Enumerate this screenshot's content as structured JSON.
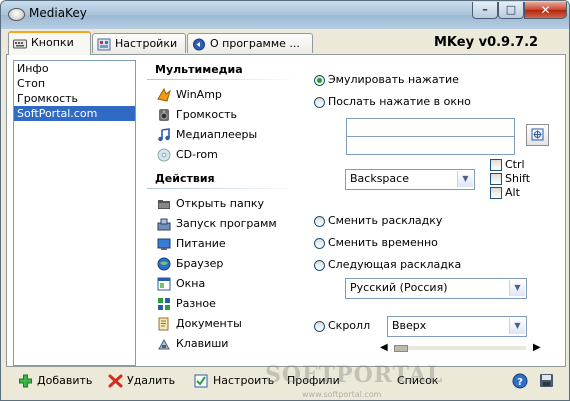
{
  "window": {
    "title": "MediaKey",
    "buttons": {
      "minimize": "–",
      "maximize": "□",
      "close": "✕"
    }
  },
  "tabs": [
    {
      "label": "Кнопки",
      "icon": "keyboard-icon",
      "active": true
    },
    {
      "label": "Настройки",
      "icon": "settings-icon",
      "active": false
    },
    {
      "label": "О программе ...",
      "icon": "info-icon",
      "active": false
    }
  ],
  "version": "MKey v0.9.7.2",
  "key_list": {
    "items": [
      "Инфо",
      "Стоп",
      "Громкость",
      "SoftPortal.com"
    ],
    "selected": "SoftPortal.com"
  },
  "categories": {
    "multimedia": {
      "title": "Мультимедиа",
      "items": [
        {
          "label": "WinAmp",
          "icon": "winamp-icon"
        },
        {
          "label": "Громкость",
          "icon": "speaker-icon"
        },
        {
          "label": "Медиаплееры",
          "icon": "music-note-icon"
        },
        {
          "label": "CD-rom",
          "icon": "cd-icon"
        }
      ]
    },
    "actions": {
      "title": "Действия",
      "items": [
        {
          "label": "Открыть папку",
          "icon": "folder-icon"
        },
        {
          "label": "Запуск программ",
          "icon": "run-icon"
        },
        {
          "label": "Питание",
          "icon": "power-icon"
        },
        {
          "label": "Браузер",
          "icon": "browser-icon"
        },
        {
          "label": "Окна",
          "icon": "windows-icon"
        },
        {
          "label": "Разное",
          "icon": "misc-icon"
        },
        {
          "label": "Документы",
          "icon": "documents-icon"
        },
        {
          "label": "Клавиши",
          "icon": "keys-icon"
        }
      ]
    }
  },
  "options": {
    "emulate_press": "Эмулировать нажатие",
    "send_to_window": "Послать нажатие в окно",
    "key_combo_value": "Backspace",
    "modifiers": {
      "ctrl": "Ctrl",
      "shift": "Shift",
      "alt": "Alt"
    },
    "change_layout": "Сменить раскладку",
    "change_temp": "Сменить временно",
    "next_layout": "Следующая раскладка",
    "layout_value": "Русский (Россия)",
    "scroll": "Скролл",
    "scroll_value": "Вверх",
    "selected_option": "emulate_press"
  },
  "toolbar": {
    "add": "Добавить",
    "delete": "Удалить",
    "configure": "Настроить",
    "profiles": "Профили",
    "list": "Список"
  },
  "watermark": {
    "text": "SOFTPORTAL",
    "sub": "www.softportal.com"
  },
  "colors": {
    "selection": "#316ac5",
    "active_tab": "#f5a623",
    "radio_on": "#21a121"
  }
}
